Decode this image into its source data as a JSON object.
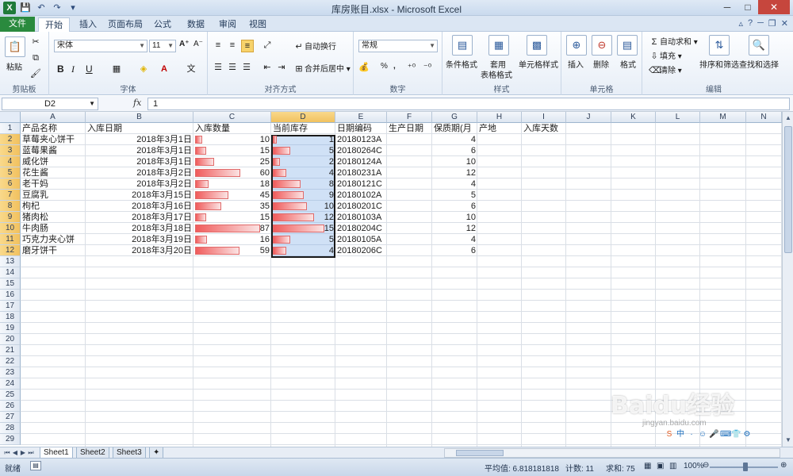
{
  "window": {
    "title": "库房账目.xlsx - Microsoft Excel",
    "minimize": "─",
    "maximize": "□",
    "close": "✕"
  },
  "ribbon_tabs": [
    "文件",
    "开始",
    "插入",
    "页面布局",
    "公式",
    "数据",
    "审阅",
    "视图"
  ],
  "ribbon_tab_active": "开始",
  "ribbon": {
    "clipboard": {
      "paste": "粘贴",
      "label": "剪贴板"
    },
    "font": {
      "name": "宋体",
      "size": "11",
      "bold": "B",
      "italic": "I",
      "underline": "U",
      "grow": "A⁺",
      "shrink": "A⁻",
      "label": "字体"
    },
    "alignment": {
      "wrap": "自动换行",
      "merge": "合并后居中",
      "label": "对齐方式"
    },
    "number": {
      "format": "常规",
      "percent": "%",
      "comma": ",",
      "label": "数字"
    },
    "styles": {
      "conditional": "条件格式",
      "table_line1": "套用",
      "table_line2": "表格格式",
      "cell_styles": "单元格样式",
      "label": "样式"
    },
    "cells": {
      "insert": "插入",
      "delete": "删除",
      "format": "格式",
      "label": "单元格"
    },
    "editing": {
      "autosum": "自动求和",
      "fill": "填充",
      "clear": "清除",
      "sort": "排序和筛选",
      "find": "查找和选择",
      "label": "编辑"
    }
  },
  "formula_bar": {
    "name_box": "D2",
    "fx": "fx",
    "value": "1"
  },
  "columns": [
    "A",
    "B",
    "C",
    "D",
    "E",
    "F",
    "G",
    "H",
    "I",
    "J",
    "K",
    "L",
    "M",
    "N"
  ],
  "selected_column": "D",
  "row_numbers": [
    "1",
    "2",
    "3",
    "4",
    "5",
    "6",
    "7",
    "8",
    "9",
    "10",
    "11",
    "12",
    "13",
    "14",
    "15",
    "16",
    "17",
    "18",
    "19",
    "20",
    "21",
    "22",
    "23",
    "24",
    "25",
    "26",
    "27",
    "28",
    "29"
  ],
  "headers": {
    "A": "产品名称",
    "B": "入库日期",
    "C": "入库数量",
    "D": "当前库存",
    "E": "日期编码",
    "F": "生产日期",
    "G": "保质期(月",
    "H": "产地",
    "I": "入库天数"
  },
  "rows": [
    {
      "name": "草莓夹心饼干",
      "date": "2018年3月1日",
      "qty": 10,
      "stock": 1,
      "code": "20180123A",
      "shelf": 4
    },
    {
      "name": "蓝莓果酱",
      "date": "2018年3月1日",
      "qty": 15,
      "stock": 5,
      "code": "20180264C",
      "shelf": 6
    },
    {
      "name": "威化饼",
      "date": "2018年3月1日",
      "qty": 25,
      "stock": 2,
      "code": "20180124A",
      "shelf": 10
    },
    {
      "name": "花生酱",
      "date": "2018年3月2日",
      "qty": 60,
      "stock": 4,
      "code": "20180231A",
      "shelf": 12
    },
    {
      "name": "老干妈",
      "date": "2018年3月2日",
      "qty": 18,
      "stock": 8,
      "code": "20180121C",
      "shelf": 4
    },
    {
      "name": "豆腐乳",
      "date": "2018年3月15日",
      "qty": 45,
      "stock": 9,
      "code": "20180102A",
      "shelf": 5
    },
    {
      "name": "枸杞",
      "date": "2018年3月16日",
      "qty": 35,
      "stock": 10,
      "code": "20180201C",
      "shelf": 6
    },
    {
      "name": "猪肉松",
      "date": "2018年3月17日",
      "qty": 15,
      "stock": 12,
      "code": "20180103A",
      "shelf": 10
    },
    {
      "name": "牛肉肠",
      "date": "2018年3月18日",
      "qty": 87,
      "stock": 15,
      "code": "20180204C",
      "shelf": 12
    },
    {
      "name": "巧克力夹心饼",
      "date": "2018年3月19日",
      "qty": 16,
      "stock": 5,
      "code": "20180105A",
      "shelf": 4
    },
    {
      "name": "磨牙饼干",
      "date": "2018年3月20日",
      "qty": 59,
      "stock": 4,
      "code": "20180206C",
      "shelf": 6
    }
  ],
  "data_bar_max": {
    "qty": 87,
    "stock": 15
  },
  "data_bar_color": "#f05b5b",
  "selection_color": "#9cc3ef",
  "sheets": [
    "Sheet1",
    "Sheet2",
    "Sheet3"
  ],
  "active_sheet": "Sheet1",
  "status": {
    "mode": "就绪",
    "average": "平均值: 6.818181818",
    "count": "计数: 11",
    "sum": "求和: 75",
    "zoom": "100%"
  },
  "watermark": {
    "text": "Baidu经验",
    "sub": "jingyan.baidu.com"
  }
}
